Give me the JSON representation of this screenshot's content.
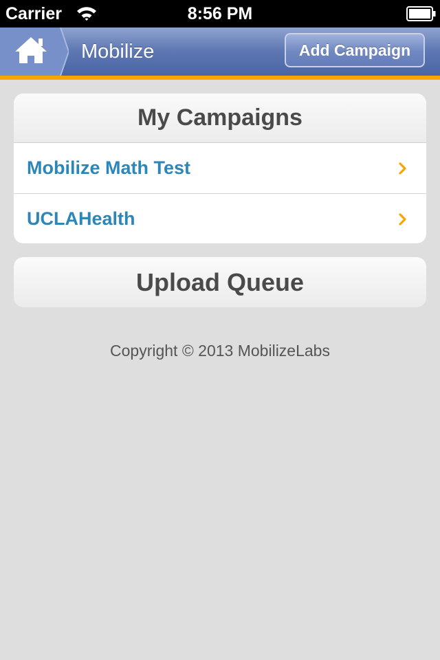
{
  "status_bar": {
    "carrier": "Carrier",
    "time": "8:56 PM",
    "icons": [
      "wifi-icon",
      "battery-icon"
    ]
  },
  "header": {
    "title": "Mobilize",
    "home_icon": "home-icon",
    "add_campaign_label": "Add Campaign",
    "accent_color": "#f7a600",
    "bar_color": "#5f78b3"
  },
  "campaigns": {
    "title": "My Campaigns",
    "items": [
      {
        "label": "Mobilize Math Test"
      },
      {
        "label": "UCLAHealth"
      }
    ],
    "link_color": "#2d86b8",
    "chevron_color": "#f7a600"
  },
  "upload_queue": {
    "label": "Upload Queue"
  },
  "footer": {
    "copyright": "Copyright © 2013 MobilizeLabs"
  }
}
